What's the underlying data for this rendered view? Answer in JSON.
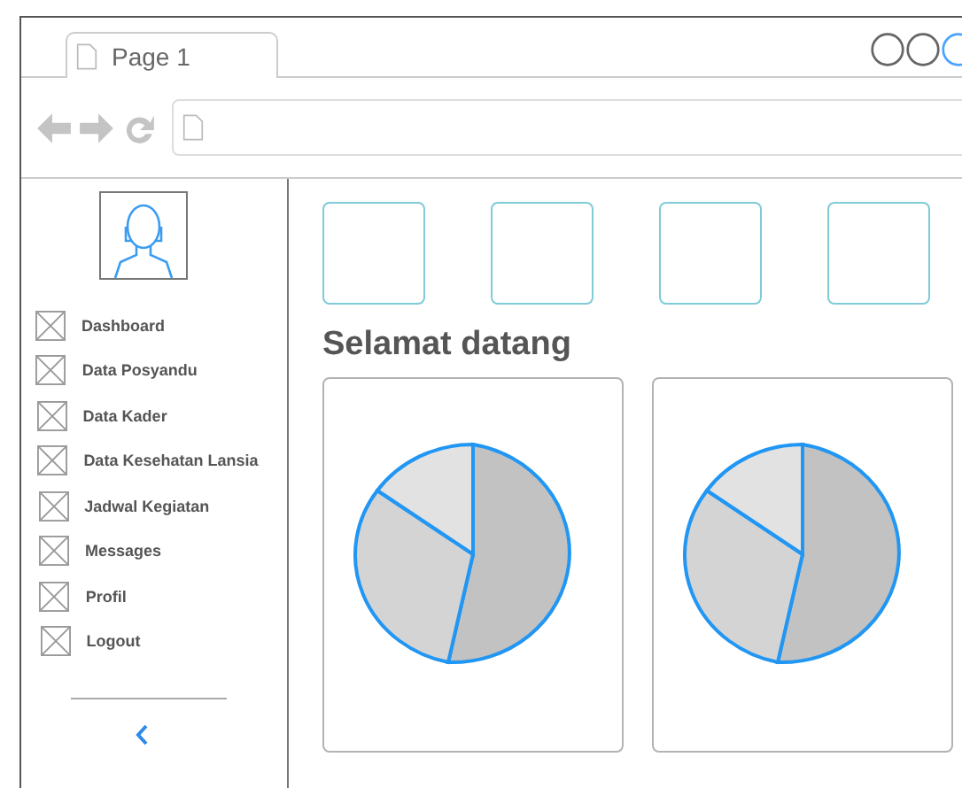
{
  "browser": {
    "tab_label": "Page 1"
  },
  "sidebar": {
    "items": [
      {
        "label": "Dashboard"
      },
      {
        "label": "Data Posyandu"
      },
      {
        "label": "Data Kader"
      },
      {
        "label": "Data Kesehatan Lansia"
      },
      {
        "label": "Jadwal Kegiatan"
      },
      {
        "label": "Messages"
      },
      {
        "label": "Profil"
      },
      {
        "label": "Logout"
      }
    ]
  },
  "tiles": [
    {
      "kind": "blank"
    },
    {
      "kind": "blank"
    },
    {
      "kind": "blank"
    },
    {
      "kind": "blank"
    }
  ],
  "heading": "Selamat datang",
  "cards": [
    {
      "kind": "pie"
    },
    {
      "kind": "pie"
    }
  ]
}
